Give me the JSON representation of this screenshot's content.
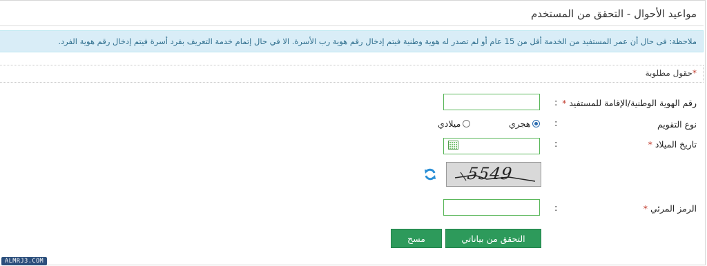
{
  "header": {
    "title": "مواعيد الأحوال - التحقق من المستخدم"
  },
  "note": {
    "text": "ملاحظة: فى حال أن عمر المستفيد من الخدمة أقل من 15 عام أو لم تصدر له هوية وطنية فيتم إدخال رقم هوية رب الأسرة. الا في حال إتمام خدمة التعريف بفرد أسرة فيتم إدخال رقم هوية الفرد."
  },
  "required_note": {
    "star": "*",
    "label": "حقول مطلوبة"
  },
  "form": {
    "colon": ":",
    "required_star": "*",
    "id_field": {
      "label": "رقم الهوية الوطنية/الإقامة للمستفيد",
      "value": ""
    },
    "calendar_type": {
      "label": "نوع التقويم",
      "options": [
        {
          "label": "هجري",
          "checked": true
        },
        {
          "label": "ميلادي",
          "checked": false
        }
      ]
    },
    "birth_date": {
      "label": "تاريخ الميلاد",
      "value": "",
      "icon": "calendar-icon"
    },
    "captcha": {
      "code": "5549",
      "refresh_icon": "refresh-icon"
    },
    "visual_code": {
      "label": "الرمز المرئي",
      "value": ""
    }
  },
  "actions": {
    "verify_label": "التحقق من بياناتي",
    "clear_label": "مسح"
  },
  "colors": {
    "accent": "#2d9a5b",
    "note_bg": "#d9edf7",
    "note_text": "#31708f",
    "required": "#c0392b"
  },
  "watermark": {
    "text": "ALMRJ3.COM"
  }
}
